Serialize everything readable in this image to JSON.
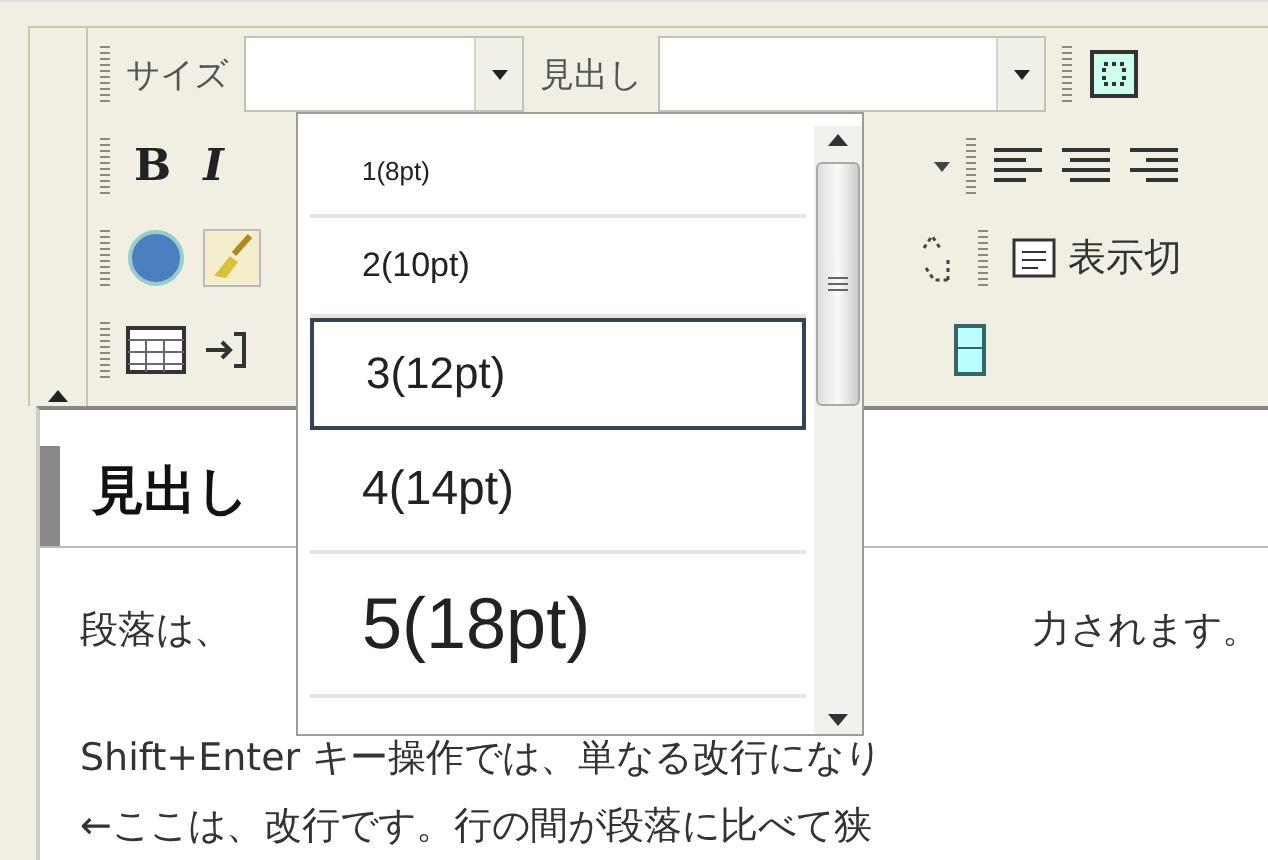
{
  "toolbar": {
    "size_label": "サイズ",
    "heading_label": "見出し",
    "bold": "B",
    "italic": "I",
    "view_toggle": "表示切"
  },
  "size_dropdown": {
    "options": [
      {
        "label": "1(8pt)",
        "selected": false
      },
      {
        "label": "2(10pt)",
        "selected": false
      },
      {
        "label": "3(12pt)",
        "selected": true
      },
      {
        "label": "4(14pt)",
        "selected": false
      },
      {
        "label": "5(18pt)",
        "selected": false
      }
    ]
  },
  "editor": {
    "heading": "見出し",
    "paragraph_start": "段落は、",
    "paragraph_end": "力されます。",
    "lines": [
      "Shift+Enter キー操作では、単なる改行になり",
      "←ここは、改行です。行の間が段落に比べて狭"
    ]
  }
}
